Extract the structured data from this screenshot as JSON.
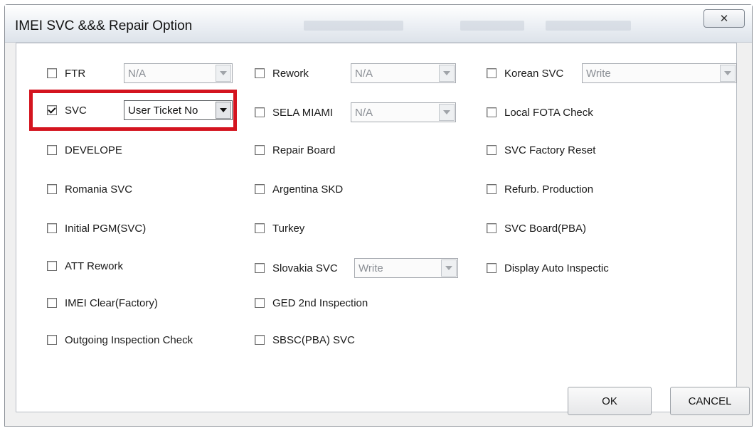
{
  "window": {
    "title": "IMEI SVC &&& Repair Option",
    "close_glyph": "✕"
  },
  "options": {
    "ftr": {
      "label": "FTR",
      "checked": false,
      "select_value": "N/A"
    },
    "svc": {
      "label": "SVC",
      "checked": true,
      "select_value": "User Ticket No"
    },
    "develope": {
      "label": "DEVELOPE",
      "checked": false
    },
    "romania_svc": {
      "label": "Romania SVC",
      "checked": false
    },
    "initial_pgm": {
      "label": "Initial PGM(SVC)",
      "checked": false
    },
    "att_rework": {
      "label": "ATT Rework",
      "checked": false
    },
    "imei_clear": {
      "label": "IMEI Clear(Factory)",
      "checked": false
    },
    "outgoing_inspection": {
      "label": "Outgoing Inspection Check",
      "checked": false
    },
    "rework": {
      "label": "Rework",
      "checked": false,
      "select_value": "N/A"
    },
    "sela_miami": {
      "label": "SELA MIAMI",
      "checked": false,
      "select_value": "N/A"
    },
    "repair_board": {
      "label": "Repair Board",
      "checked": false
    },
    "argentina_skd": {
      "label": "Argentina SKD",
      "checked": false
    },
    "turkey": {
      "label": "Turkey",
      "checked": false
    },
    "slovakia_svc": {
      "label": "Slovakia SVC",
      "checked": false,
      "select_value": "Write"
    },
    "ged_2nd": {
      "label": "GED 2nd Inspection",
      "checked": false
    },
    "sbsc_svc": {
      "label": "SBSC(PBA) SVC",
      "checked": false
    },
    "korean_svc": {
      "label": "Korean SVC",
      "checked": false,
      "select_value": "Write"
    },
    "local_fota": {
      "label": "Local FOTA Check",
      "checked": false
    },
    "svc_factory_reset": {
      "label": "SVC Factory Reset",
      "checked": false
    },
    "refurb_production": {
      "label": "Refurb. Production",
      "checked": false
    },
    "svc_board": {
      "label": "SVC Board(PBA)",
      "checked": false
    },
    "display_auto": {
      "label": "Display Auto Inspectic",
      "checked": false
    }
  },
  "buttons": {
    "ok": "OK",
    "cancel": "CANCEL"
  },
  "colors": {
    "highlight": "#d4141f"
  }
}
